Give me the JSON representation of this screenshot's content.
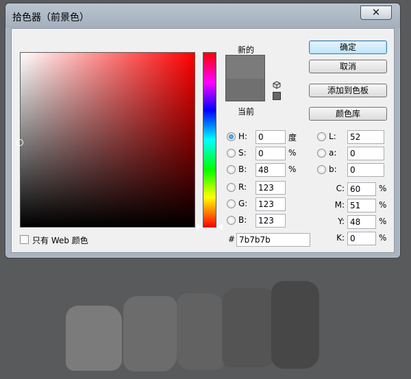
{
  "dialog": {
    "title": "拾色器（前景色）",
    "close_label": "✕"
  },
  "swatch": {
    "new_label": "新的",
    "current_label": "当前",
    "new_color": "#7b7b7b",
    "current_color": "#707070"
  },
  "buttons": {
    "ok": "确定",
    "cancel": "取消",
    "add_to_swatches": "添加到色板",
    "color_libraries": "颜色库"
  },
  "hsb": {
    "h": {
      "label": "H:",
      "value": "0",
      "unit": "度"
    },
    "s": {
      "label": "S:",
      "value": "0",
      "unit": "%"
    },
    "b": {
      "label": "B:",
      "value": "48",
      "unit": "%"
    }
  },
  "rgb": {
    "r": {
      "label": "R:",
      "value": "123"
    },
    "g": {
      "label": "G:",
      "value": "123"
    },
    "b": {
      "label": "B:",
      "value": "123"
    }
  },
  "lab": {
    "l": {
      "label": "L:",
      "value": "52"
    },
    "a": {
      "label": "a:",
      "value": "0"
    },
    "b": {
      "label": "b:",
      "value": "0"
    }
  },
  "cmyk": {
    "c": {
      "label": "C:",
      "value": "60",
      "unit": "%"
    },
    "m": {
      "label": "M:",
      "value": "51",
      "unit": "%"
    },
    "y": {
      "label": "Y:",
      "value": "48",
      "unit": "%"
    },
    "k": {
      "label": "K:",
      "value": "0",
      "unit": "%"
    }
  },
  "hex": {
    "label": "#",
    "value": "7b7b7b"
  },
  "websafe_label": "只有 Web 颜色",
  "selected_mode": "H"
}
